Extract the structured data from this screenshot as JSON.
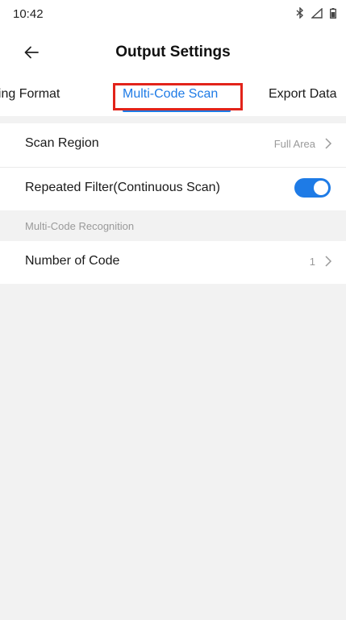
{
  "status_bar": {
    "time": "10:42",
    "icons": [
      "bluetooth-icon",
      "signal-icon",
      "battery-icon"
    ]
  },
  "header": {
    "title": "Output Settings",
    "back_icon": "arrow-left-icon"
  },
  "tabs": [
    {
      "label": "ding Format",
      "active": false
    },
    {
      "label": "Multi-Code Scan",
      "active": true
    },
    {
      "label": "Export Data",
      "active": false
    }
  ],
  "settings": {
    "scan_region": {
      "label": "Scan Region",
      "value": "Full Area"
    },
    "repeated_filter": {
      "label": "Repeated Filter(Continuous Scan)",
      "enabled": true
    },
    "section_header": "Multi-Code Recognition",
    "number_of_code": {
      "label": "Number of Code",
      "value": "1"
    }
  },
  "colors": {
    "accent": "#1e7be6",
    "highlight": "#e2231a",
    "background": "#f2f2f2"
  }
}
